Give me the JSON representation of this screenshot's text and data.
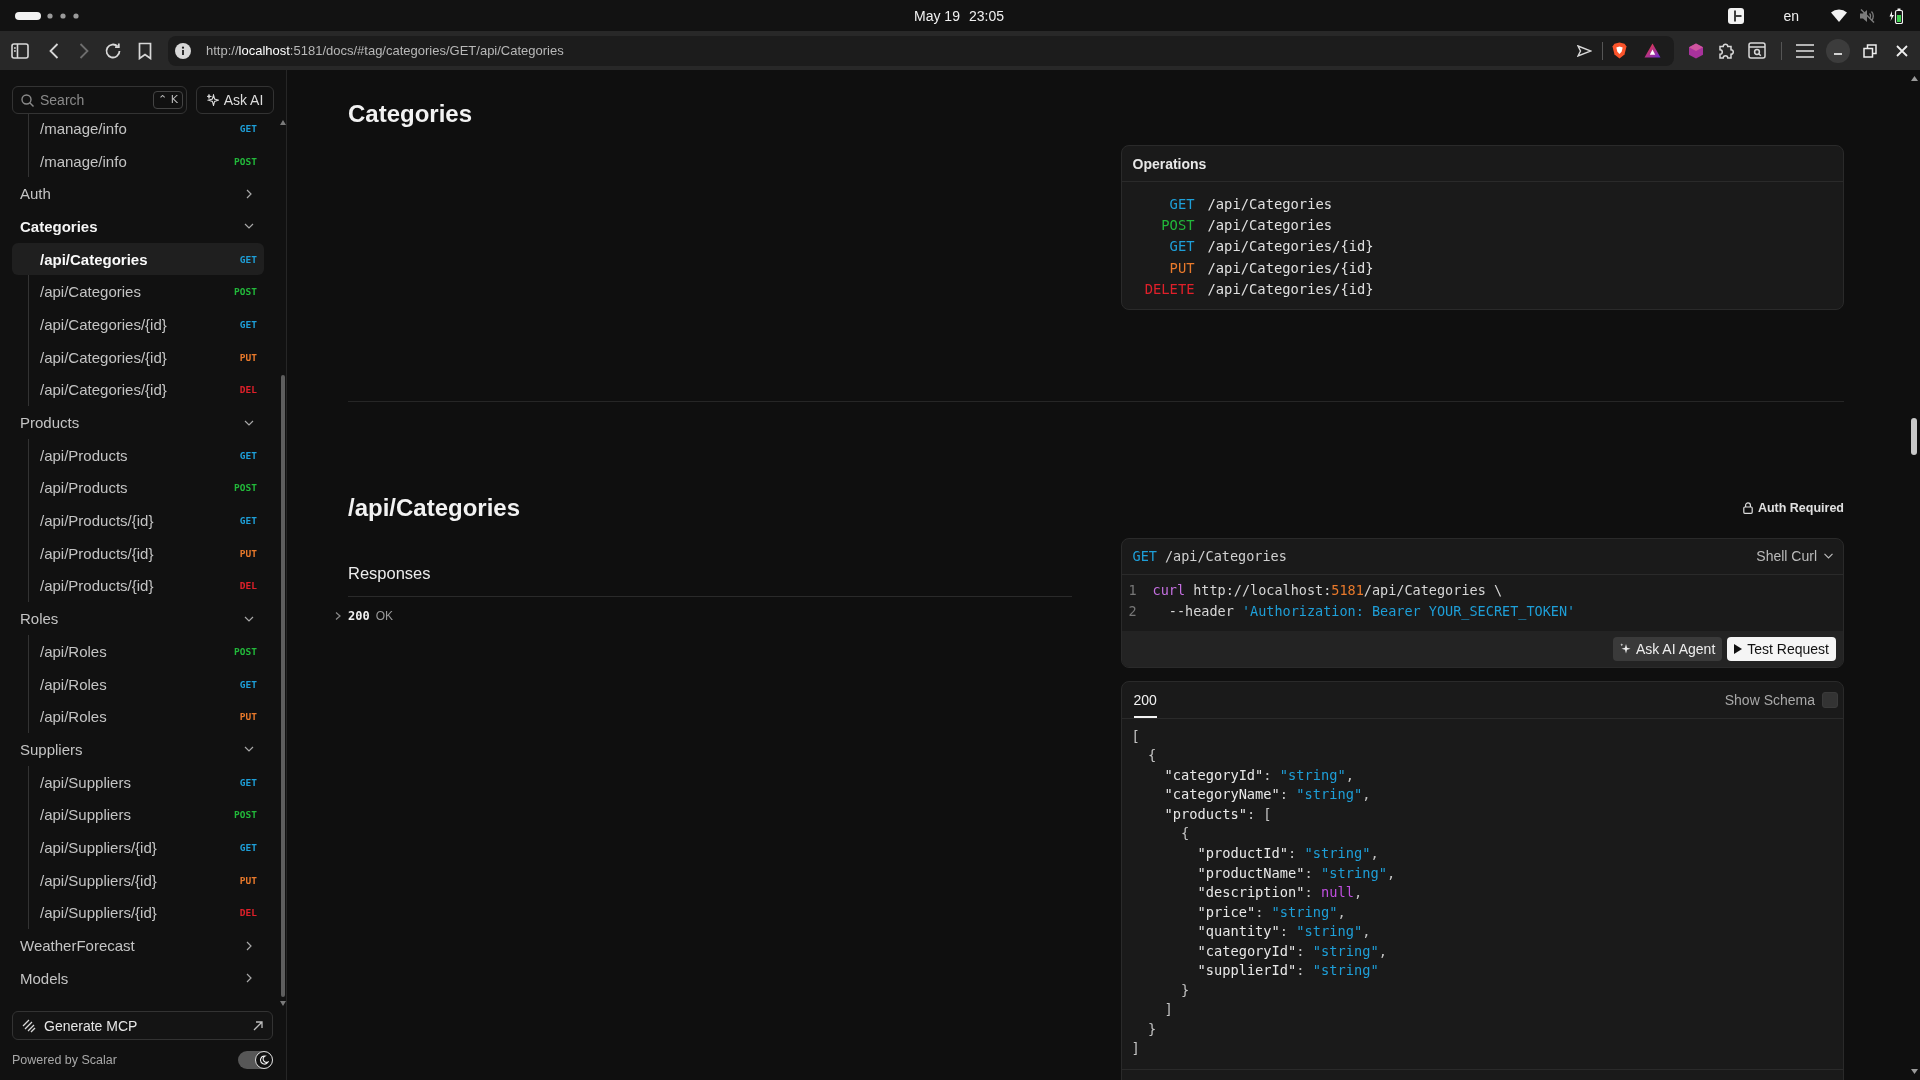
{
  "system_bar": {
    "date": "May 19",
    "time": "23:05",
    "language": "en"
  },
  "browser": {
    "url": {
      "scheme": "http://",
      "host": "localhost",
      "path": ":5181/docs/#tag/categories/GET/api/Categories"
    }
  },
  "sidebar": {
    "search": {
      "placeholder": "Search",
      "shortcut": "⌃ K"
    },
    "ask_ai_button": "Ask AI",
    "tree": [
      {
        "children": [
          {
            "label": "/manage/info",
            "method": "GET",
            "color": "#1e9fd8",
            "selected": false
          },
          {
            "label": "/manage/info",
            "method": "POST",
            "color": "#22b83a",
            "selected": false
          }
        ]
      },
      {
        "label": "Auth",
        "expanded": false
      },
      {
        "label": "Categories",
        "expanded": true,
        "children": [
          {
            "label": "/api/Categories",
            "method": "GET",
            "color": "#1e9fd8",
            "selected": true
          },
          {
            "label": "/api/Categories",
            "method": "POST",
            "color": "#22b83a",
            "selected": false
          },
          {
            "label": "/api/Categories/{id}",
            "method": "GET",
            "color": "#1e9fd8",
            "selected": false
          },
          {
            "label": "/api/Categories/{id}",
            "method": "PUT",
            "color": "#e8792b",
            "selected": false
          },
          {
            "label": "/api/Categories/{id}",
            "method": "DEL",
            "color": "#e0202a",
            "selected": false
          }
        ]
      },
      {
        "label": "Products",
        "expanded": true,
        "children": [
          {
            "label": "/api/Products",
            "method": "GET",
            "color": "#1e9fd8",
            "selected": false
          },
          {
            "label": "/api/Products",
            "method": "POST",
            "color": "#22b83a",
            "selected": false
          },
          {
            "label": "/api/Products/{id}",
            "method": "GET",
            "color": "#1e9fd8",
            "selected": false
          },
          {
            "label": "/api/Products/{id}",
            "method": "PUT",
            "color": "#e8792b",
            "selected": false
          },
          {
            "label": "/api/Products/{id}",
            "method": "DEL",
            "color": "#e0202a",
            "selected": false
          }
        ]
      },
      {
        "label": "Roles",
        "expanded": true,
        "children": [
          {
            "label": "/api/Roles",
            "method": "POST",
            "color": "#22b83a",
            "selected": false
          },
          {
            "label": "/api/Roles",
            "method": "GET",
            "color": "#1e9fd8",
            "selected": false
          },
          {
            "label": "/api/Roles",
            "method": "PUT",
            "color": "#e8792b",
            "selected": false
          }
        ]
      },
      {
        "label": "Suppliers",
        "expanded": true,
        "children": [
          {
            "label": "/api/Suppliers",
            "method": "GET",
            "color": "#1e9fd8",
            "selected": false
          },
          {
            "label": "/api/Suppliers",
            "method": "POST",
            "color": "#22b83a",
            "selected": false
          },
          {
            "label": "/api/Suppliers/{id}",
            "method": "GET",
            "color": "#1e9fd8",
            "selected": false
          },
          {
            "label": "/api/Suppliers/{id}",
            "method": "PUT",
            "color": "#e8792b",
            "selected": false
          },
          {
            "label": "/api/Suppliers/{id}",
            "method": "DEL",
            "color": "#e0202a",
            "selected": false
          }
        ]
      },
      {
        "label": "WeatherForecast",
        "expanded": false
      },
      {
        "label": "Models",
        "expanded": false
      }
    ],
    "generate_button": "Generate MCP",
    "footer": "Powered by Scalar",
    "dark_mode": true
  },
  "tag_section": {
    "title": "Categories",
    "operations": {
      "title": "Operations",
      "rows": [
        {
          "method": "GET",
          "path": "/api/Categories",
          "color": "#1e9fd8"
        },
        {
          "method": "POST",
          "path": "/api/Categories",
          "color": "#22b83a"
        },
        {
          "method": "GET",
          "path": "/api/Categories/{id}",
          "color": "#1e9fd8"
        },
        {
          "method": "PUT",
          "path": "/api/Categories/{id}",
          "color": "#e8792b"
        },
        {
          "method": "DELETE",
          "path": "/api/Categories/{id}",
          "color": "#e0202a"
        }
      ]
    }
  },
  "endpoint": {
    "title": "/api/Categories",
    "auth": "Auth Required",
    "responses": {
      "title": "Responses",
      "items": [
        {
          "code": "200",
          "description": "OK",
          "expanded": false
        }
      ]
    },
    "request": {
      "method": "GET",
      "color": "#1e9fd8",
      "path": "/api/Categories",
      "client": "Shell Curl",
      "lines": [
        {
          "number": "1",
          "tokens": [
            {
              "text": "curl",
              "kind": "keyword"
            },
            {
              "text": " http://localhost:",
              "kind": "plain"
            },
            {
              "text": "5181",
              "kind": "number"
            },
            {
              "text": "/api/Categories \\",
              "kind": "plain"
            }
          ]
        },
        {
          "number": "2",
          "tokens": [
            {
              "text": "  --header ",
              "kind": "plain"
            },
            {
              "text": "'Authorization: Bearer YOUR_SECRET_TOKEN'",
              "kind": "string"
            }
          ]
        }
      ],
      "buttons": [
        {
          "label": "Ask AI Agent",
          "kind": "secondary"
        },
        {
          "label": "Test Request",
          "kind": "primary"
        }
      ]
    },
    "example": {
      "tabs": [
        {
          "label": "200",
          "selected": true
        }
      ],
      "show_schema": {
        "label": "Show Schema",
        "checked": false
      },
      "lines": [
        [
          {
            "text": "[",
            "kind": "punct"
          }
        ],
        [
          {
            "text": "  {",
            "kind": "punct"
          }
        ],
        [
          {
            "text": "    \"categoryId\"",
            "kind": "key"
          },
          {
            "text": ": ",
            "kind": "punct"
          },
          {
            "text": "\"string\"",
            "kind": "string"
          },
          {
            "text": ",",
            "kind": "punct"
          }
        ],
        [
          {
            "text": "    \"categoryName\"",
            "kind": "key"
          },
          {
            "text": ": ",
            "kind": "punct"
          },
          {
            "text": "\"string\"",
            "kind": "string"
          },
          {
            "text": ",",
            "kind": "punct"
          }
        ],
        [
          {
            "text": "    \"products\"",
            "kind": "key"
          },
          {
            "text": ": [",
            "kind": "punct"
          }
        ],
        [
          {
            "text": "      {",
            "kind": "punct"
          }
        ],
        [
          {
            "text": "        \"productId\"",
            "kind": "key"
          },
          {
            "text": ": ",
            "kind": "punct"
          },
          {
            "text": "\"string\"",
            "kind": "string"
          },
          {
            "text": ",",
            "kind": "punct"
          }
        ],
        [
          {
            "text": "        \"productName\"",
            "kind": "key"
          },
          {
            "text": ": ",
            "kind": "punct"
          },
          {
            "text": "\"string\"",
            "kind": "string"
          },
          {
            "text": ",",
            "kind": "punct"
          }
        ],
        [
          {
            "text": "        \"description\"",
            "kind": "key"
          },
          {
            "text": ": ",
            "kind": "punct"
          },
          {
            "text": "null",
            "kind": "null"
          },
          {
            "text": ",",
            "kind": "punct"
          }
        ],
        [
          {
            "text": "        \"price\"",
            "kind": "key"
          },
          {
            "text": ": ",
            "kind": "punct"
          },
          {
            "text": "\"string\"",
            "kind": "string"
          },
          {
            "text": ",",
            "kind": "punct"
          }
        ],
        [
          {
            "text": "        \"quantity\"",
            "kind": "key"
          },
          {
            "text": ": ",
            "kind": "punct"
          },
          {
            "text": "\"string\"",
            "kind": "string"
          },
          {
            "text": ",",
            "kind": "punct"
          }
        ],
        [
          {
            "text": "        \"categoryId\"",
            "kind": "key"
          },
          {
            "text": ": ",
            "kind": "punct"
          },
          {
            "text": "\"string\"",
            "kind": "string"
          },
          {
            "text": ",",
            "kind": "punct"
          }
        ],
        [
          {
            "text": "        \"supplierId\"",
            "kind": "key"
          },
          {
            "text": ": ",
            "kind": "punct"
          },
          {
            "text": "\"string\"",
            "kind": "string"
          }
        ],
        [
          {
            "text": "      }",
            "kind": "punct"
          }
        ],
        [
          {
            "text": "    ]",
            "kind": "punct"
          }
        ],
        [
          {
            "text": "  }",
            "kind": "punct"
          }
        ],
        [
          {
            "text": "]",
            "kind": "punct"
          }
        ]
      ]
    }
  }
}
